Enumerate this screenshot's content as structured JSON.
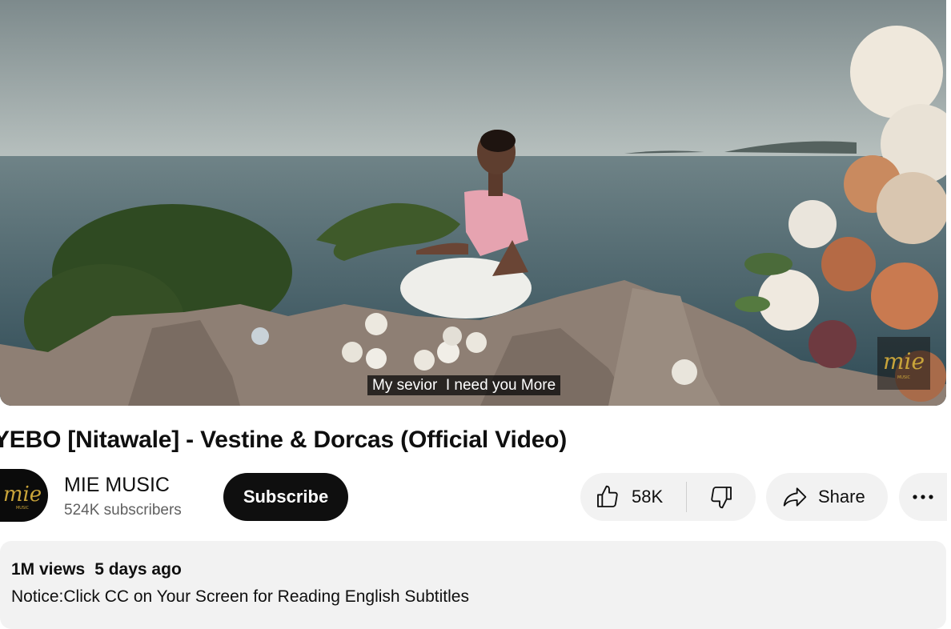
{
  "player": {
    "caption": "My sevior  I need you More",
    "watermark_text": "mie"
  },
  "video": {
    "title": "YEBO [Nitawale] - Vestine & Dorcas (Official Video)"
  },
  "channel": {
    "name": "MIE MUSIC",
    "subscribers": "524K subscribers",
    "avatar_text": "mie",
    "subscribe_label": "Subscribe"
  },
  "actions": {
    "like_count": "58K",
    "share_label": "Share"
  },
  "description": {
    "views": "1M views",
    "date": "5 days ago",
    "text": "Notice:Click CC on Your Screen for Reading English Subtitles"
  },
  "colors": {
    "subscribe_bg": "#0f0f0f",
    "chip_bg": "#f2f2f2",
    "logo_gold": "#c9a43a"
  },
  "icons": [
    "thumb-up-icon",
    "thumb-down-icon",
    "share-arrow-icon",
    "more-dots-icon"
  ]
}
